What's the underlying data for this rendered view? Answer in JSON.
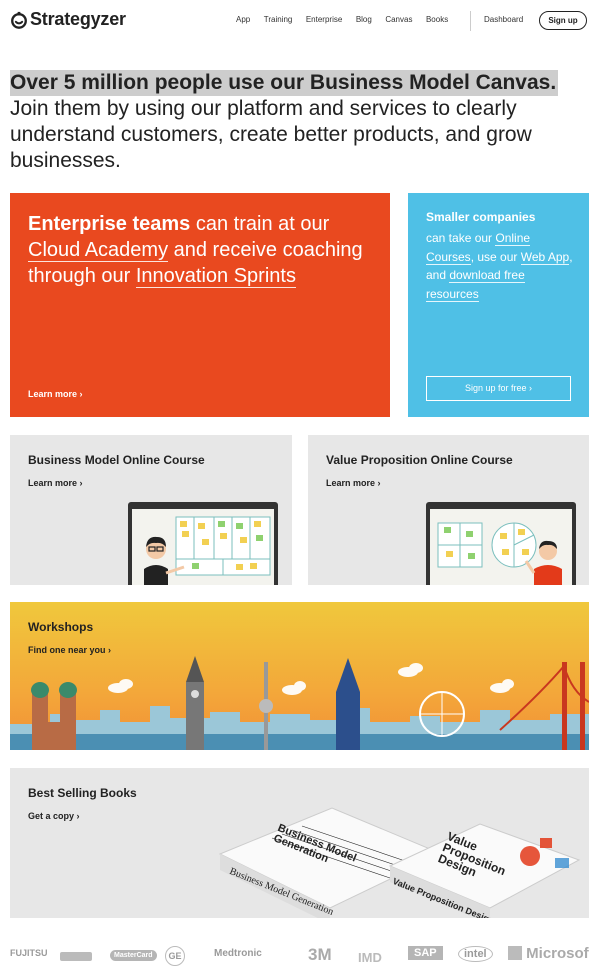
{
  "header": {
    "brand": "Strategyzer",
    "nav": [
      "App",
      "Training",
      "Enterprise",
      "Blog",
      "Canvas",
      "Books"
    ],
    "dashboard": "Dashboard",
    "signup": "Sign up"
  },
  "hero": {
    "headline": "Over 5 million people use our Business Model Canvas.",
    "subline": "Join them by using our platform and services to clearly understand customers, create better products, and grow businesses."
  },
  "enterprise": {
    "bold": "Enterprise teams",
    "t1": " can train at our ",
    "link1": "Cloud Academy",
    "t2": " and receive coaching through our ",
    "link2": "Innovation Sprints",
    "learn_more": "Learn more ›"
  },
  "smaller": {
    "title": "Smaller companies",
    "t1": "can take our ",
    "link1": "Online Courses",
    "t2": ", use our ",
    "link2": "Web App",
    "t3": ", and ",
    "link3": "download free resources",
    "button": "Sign up for free ›"
  },
  "courses": [
    {
      "title": "Business Model Online Course",
      "learn_more": "Learn more ›"
    },
    {
      "title": "Value Proposition Online Course",
      "learn_more": "Learn more ›"
    }
  ],
  "workshops": {
    "title": "Workshops",
    "link": "Find one near you ›"
  },
  "books": {
    "title": "Best Selling Books",
    "link": "Get a copy ›",
    "book1": "Business Model Generation",
    "book1_cover": "Business Model Generation",
    "book2": "Value Proposition Design",
    "book2_cover": "Value Proposition Design"
  },
  "client_logos": [
    "FUJITSU",
    "MasterCard",
    "GE",
    "Medtronic",
    "3M",
    "IMD",
    "SAP",
    "intel",
    "Microsoft"
  ],
  "colors": {
    "enterprise_bg": "#e9491f",
    "smaller_bg": "#4fc0e6",
    "card_gray": "#e7e7e7",
    "workshop_gradient": [
      "#f0c83c",
      "#f28f36"
    ]
  }
}
